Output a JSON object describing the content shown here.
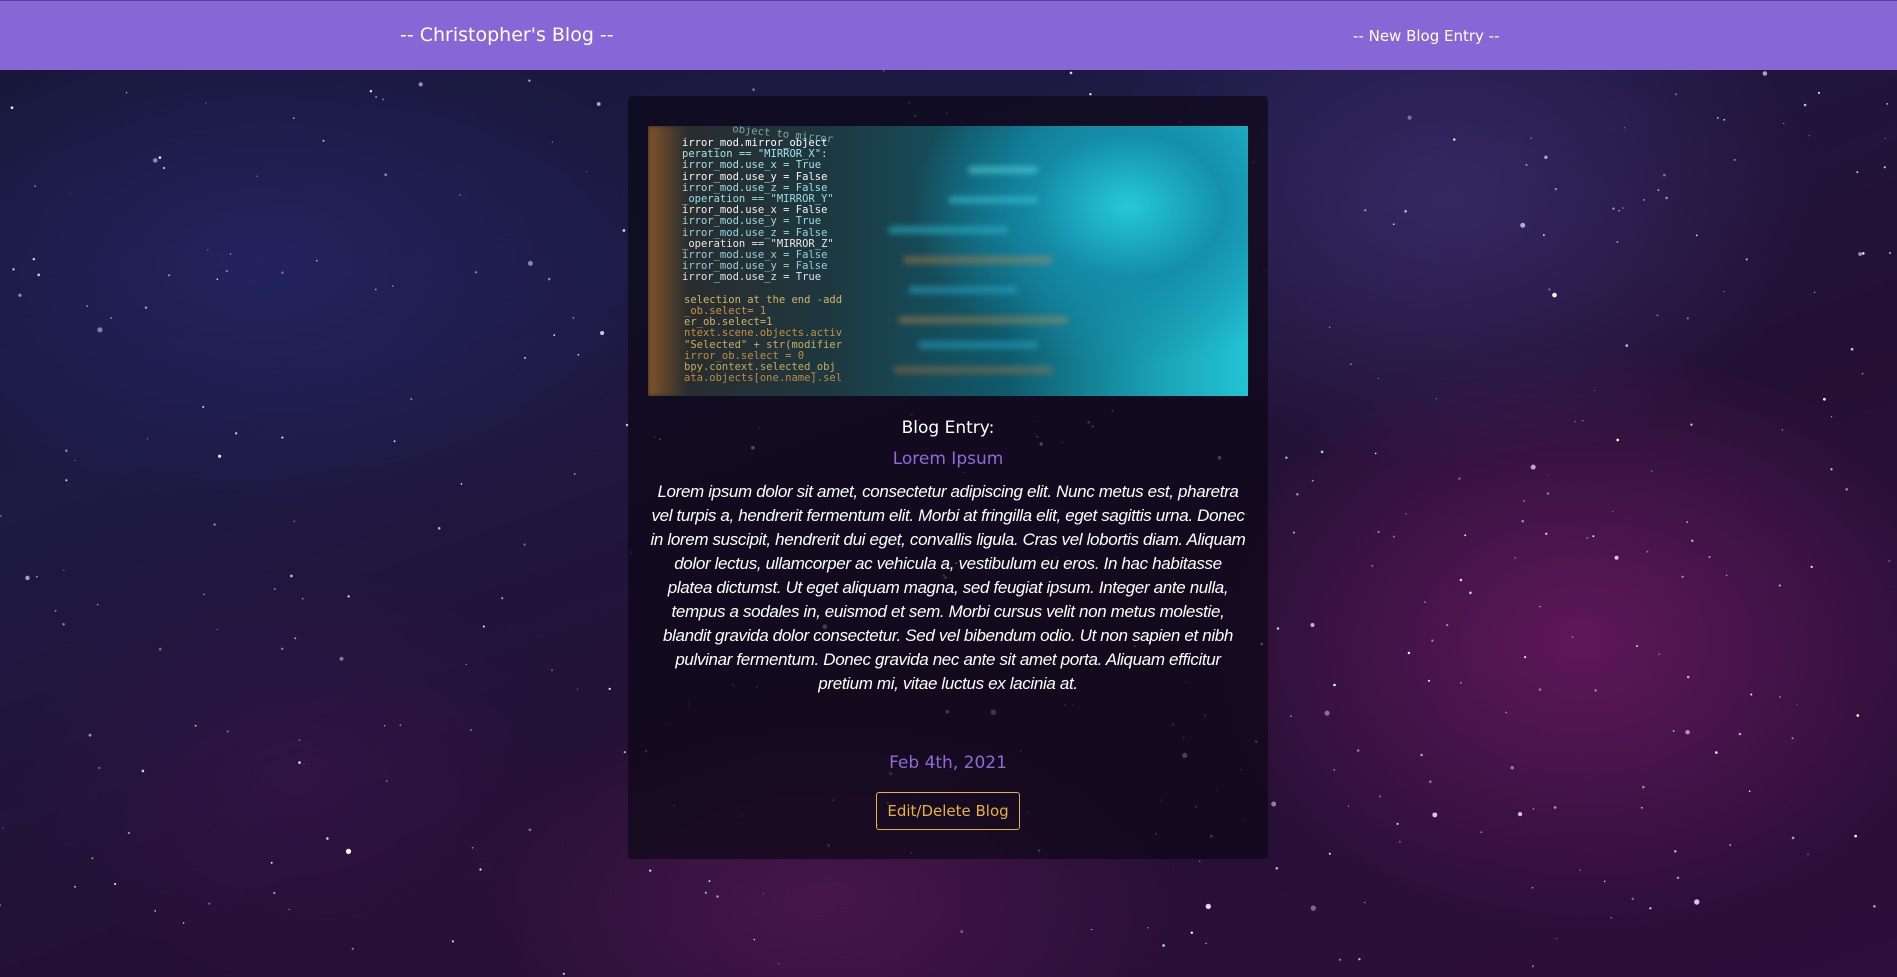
{
  "navbar": {
    "brand": "-- Christopher's Blog --",
    "new_entry_link": "-- New Blog Entry --"
  },
  "blog_card": {
    "image_description": "code screenshot",
    "label": "Blog Entry:",
    "title": "Lorem Ipsum",
    "body": "Lorem ipsum dolor sit amet, consectetur adipiscing elit. Nunc metus est, pharetra vel turpis a, hendrerit fermentum elit. Morbi at fringilla elit, eget sagittis urna. Donec in lorem suscipit, hendrerit dui eget, convallis ligula. Cras vel lobortis diam. Aliquam dolor lectus, ullamcorper ac vehicula a, vestibulum eu eros. In hac habitasse platea dictumst. Ut eget aliquam magna, sed feugiat ipsum. Integer ante nulla, tempus a sodales in, euismod et sem. Morbi cursus velit non metus molestie, blandit gravida dolor consectetur. Sed vel bibendum odio. Ut non sapien et nibh pulvinar fermentum. Donec gravida nec ante sit amet porta. Aliquam efficitur pretium mi, vitae luctus ex lacinia at.",
    "date": "Feb 4th, 2021",
    "edit_button_label": "Edit/Delete Blog"
  },
  "code_image": {
    "lines": [
      "irror_mod.mirror_object",
      "peration == \"MIRROR_X\":",
      "irror_mod.use_x = True",
      "irror_mod.use_y = False",
      "irror_mod.use_z = False",
      "_operation == \"MIRROR_Y\"",
      "irror_mod.use_x = False",
      "irror_mod.use_y = True",
      "irror_mod.use_z = False",
      "_operation == \"MIRROR_Z\"",
      "irror_mod.use_x = False",
      "irror_mod.use_y = False",
      "irror_mod.use_z = True",
      "",
      "selection at the end -add",
      "_ob.select= 1",
      "er_ob.select=1",
      "ntext.scene.objects.activ",
      "\"Selected\" + str(modifier",
      "irror_ob.select = 0",
      "bpy.context.selected_obj",
      "ata.objects[one.name].sel"
    ],
    "header_line": "object to mirror"
  },
  "colors": {
    "navbar": "#8766d6",
    "accent_purple": "#8f6ad8",
    "button_gold": "#e6b33a"
  }
}
